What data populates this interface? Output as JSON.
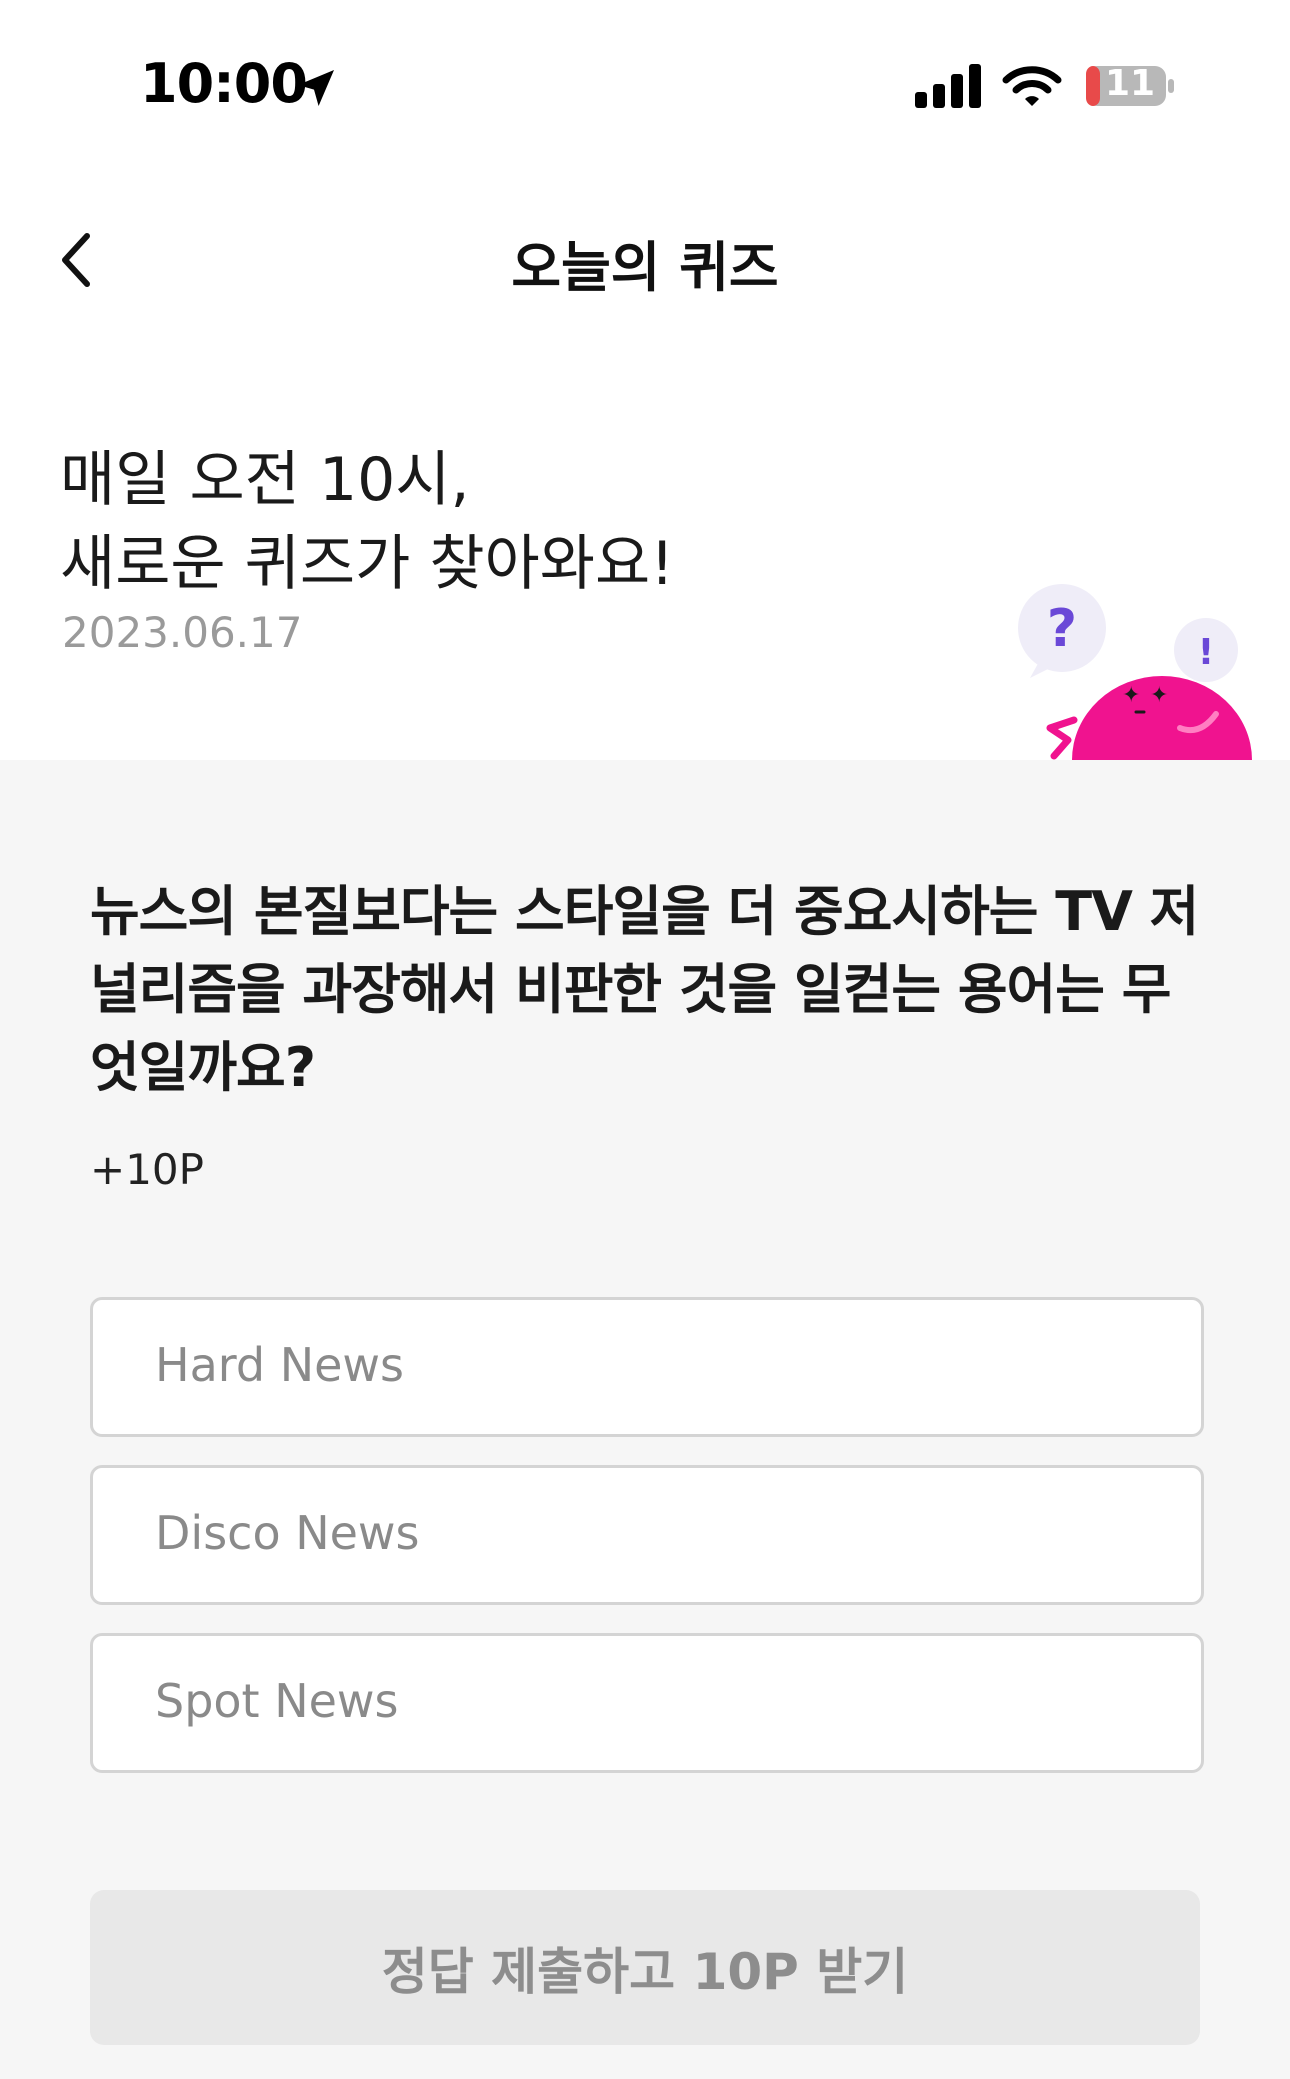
{
  "status_bar": {
    "time": "10:00",
    "battery_level": "11",
    "icons": [
      "location-arrow-icon",
      "cellular-signal-icon",
      "wifi-icon",
      "battery-icon"
    ]
  },
  "nav": {
    "title": "오늘의 퀴즈",
    "back_icon": "chevron-left-icon"
  },
  "header": {
    "headline_line1": "매일 오전 10시,",
    "headline_line2": "새로운 퀴즈가 찾아와요!",
    "date": "2023.06.17",
    "mascot_question_mark": "?",
    "mascot_exclamation_mark": "!"
  },
  "quiz": {
    "question": "뉴스의 본질보다는 스타일을 더 중요시하는 TV 저널리즘을 과장해서 비판한 것을 일컫는 용어는 무엇일까요?",
    "points": "+10P",
    "options": [
      {
        "label": "Hard News"
      },
      {
        "label": "Disco News"
      },
      {
        "label": "Spot News"
      }
    ],
    "submit_label": "정답 제출하고 10P 받기"
  },
  "colors": {
    "mascot_pink": "#f0138f",
    "bubble_lavender": "#efedf8",
    "question_mark_purple": "#6a48d7",
    "battery_red": "#e84a4a"
  }
}
